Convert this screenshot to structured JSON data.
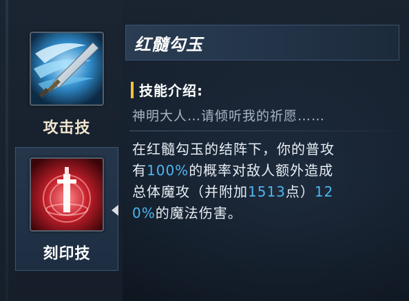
{
  "colors": {
    "highlight": "#4fb6f0",
    "section_accent": "#f3c33b",
    "label_gold": "#f1e6cf"
  },
  "skills": [
    {
      "label": "攻击技",
      "icon": "sword-slash-icon",
      "active": false
    },
    {
      "label": "刻印技",
      "icon": "red-seal-sword-icon",
      "active": true
    }
  ],
  "panel": {
    "title": "红髓勾玉",
    "section_title": "技能介绍:",
    "quote": "神明大人…请倾听我的祈愿……",
    "description": {
      "line1": "在红髓勾玉的结阵下，你的普攻",
      "line2_pre": "有",
      "line2_hl": "100%",
      "line2_post": "的概率对敌人额外造成",
      "line3_pre": "总体魔攻（并附加",
      "line3_hl1": "1513",
      "line3_mid": "点）",
      "line3_hl2": "12",
      "line4_hl": "0%",
      "line4_post": "的魔法伤害。"
    }
  }
}
